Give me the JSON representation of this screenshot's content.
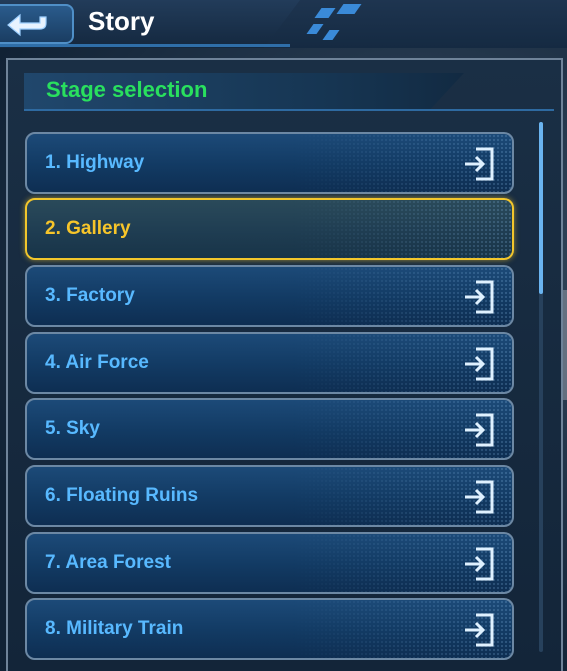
{
  "header": {
    "title": "Story",
    "back_icon": "back-arrow-icon"
  },
  "panel": {
    "section_title": "Stage selection"
  },
  "stages": [
    {
      "label": "1. Highway",
      "selected": false
    },
    {
      "label": "2. Gallery",
      "selected": true
    },
    {
      "label": "3. Factory",
      "selected": false
    },
    {
      "label": "4. Air Force",
      "selected": false
    },
    {
      "label": "5. Sky",
      "selected": false
    },
    {
      "label": "6. Floating Ruins",
      "selected": false
    },
    {
      "label": "7. Area Forest",
      "selected": false
    },
    {
      "label": "8. Military Train",
      "selected": false
    }
  ],
  "icons": {
    "stage_enter": "enter-icon"
  },
  "colors": {
    "section_title": "#29e05e",
    "stage_label": "#58b9ff",
    "selected_label": "#f7c52a",
    "selected_border": "#f2c62c"
  }
}
